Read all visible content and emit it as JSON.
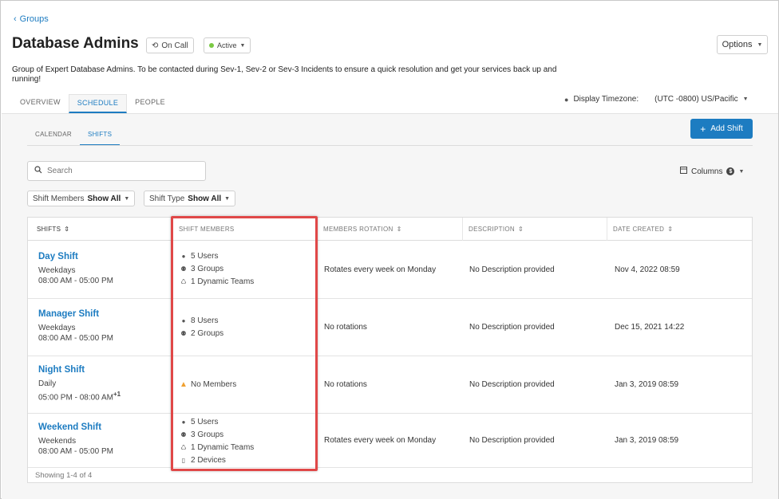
{
  "breadcrumb": {
    "label": "Groups"
  },
  "header": {
    "title": "Database Admins",
    "oncall_label": "On Call",
    "status_label": "Active",
    "options_label": "Options",
    "description": "Group of Expert Database Admins. To be contacted during Sev-1, Sev-2 or Sev-3 Incidents to ensure a quick resolution and get your services back up and running!"
  },
  "tabs": [
    {
      "label": "OVERVIEW",
      "active": false
    },
    {
      "label": "SCHEDULE",
      "active": true
    },
    {
      "label": "PEOPLE",
      "active": false
    }
  ],
  "timezone": {
    "label": "Display Timezone:",
    "value": "(UTC -0800) US/Pacific"
  },
  "subtabs": [
    {
      "label": "CALENDAR",
      "active": false
    },
    {
      "label": "SHIFTS",
      "active": true
    }
  ],
  "actions": {
    "add_shift_label": "Add Shift",
    "columns_label": "Columns"
  },
  "search": {
    "placeholder": "Search"
  },
  "filters": {
    "members_label": "Shift Members",
    "members_value": "Show All",
    "type_label": "Shift Type",
    "type_value": "Show All"
  },
  "table": {
    "headers": [
      "SHIFTS",
      "SHIFT MEMBERS",
      "MEMBERS ROTATION",
      "DESCRIPTION",
      "DATE CREATED"
    ],
    "rows": [
      {
        "name": "Day Shift",
        "frequency": "Weekdays",
        "hours": "08:00 AM - 05:00 PM",
        "hours_suffix": "",
        "members": [
          {
            "icon": "user-icon",
            "text": "5 Users"
          },
          {
            "icon": "group-icon",
            "text": "3 Groups"
          },
          {
            "icon": "dynamic-team-icon",
            "text": "1 Dynamic Teams"
          }
        ],
        "rotation": "Rotates every week on Monday",
        "description": "No Description provided",
        "created": "Nov 4, 2022 08:59"
      },
      {
        "name": "Manager Shift",
        "frequency": "Weekdays",
        "hours": "08:00 AM - 05:00 PM",
        "hours_suffix": "",
        "members": [
          {
            "icon": "user-icon",
            "text": "8 Users"
          },
          {
            "icon": "group-icon",
            "text": "2 Groups"
          }
        ],
        "rotation": "No rotations",
        "description": "No Description provided",
        "created": "Dec 15, 2021 14:22"
      },
      {
        "name": "Night Shift",
        "frequency": "Daily",
        "hours": "05:00 PM - 08:00 AM",
        "hours_suffix": "+1",
        "members": [
          {
            "icon": "warning-icon",
            "text": "No Members"
          }
        ],
        "rotation": "No rotations",
        "description": "No Description provided",
        "created": "Jan 3, 2019 08:59"
      },
      {
        "name": "Weekend Shift",
        "frequency": "Weekends",
        "hours": "08:00 AM - 05:00 PM",
        "hours_suffix": "",
        "members": [
          {
            "icon": "user-icon",
            "text": "5 Users"
          },
          {
            "icon": "group-icon",
            "text": "3 Groups"
          },
          {
            "icon": "dynamic-team-icon",
            "text": "1 Dynamic Teams"
          },
          {
            "icon": "device-icon",
            "text": "2 Devices"
          }
        ],
        "rotation": "Rotates every week on Monday",
        "description": "No Description provided",
        "created": "Jan 3, 2019 08:59"
      }
    ],
    "footer": "Showing 1-4 of 4"
  },
  "colors": {
    "accent": "#1d7cc1",
    "status_active": "#7ac943",
    "highlight": "#e04848",
    "warning": "#f0a030"
  }
}
